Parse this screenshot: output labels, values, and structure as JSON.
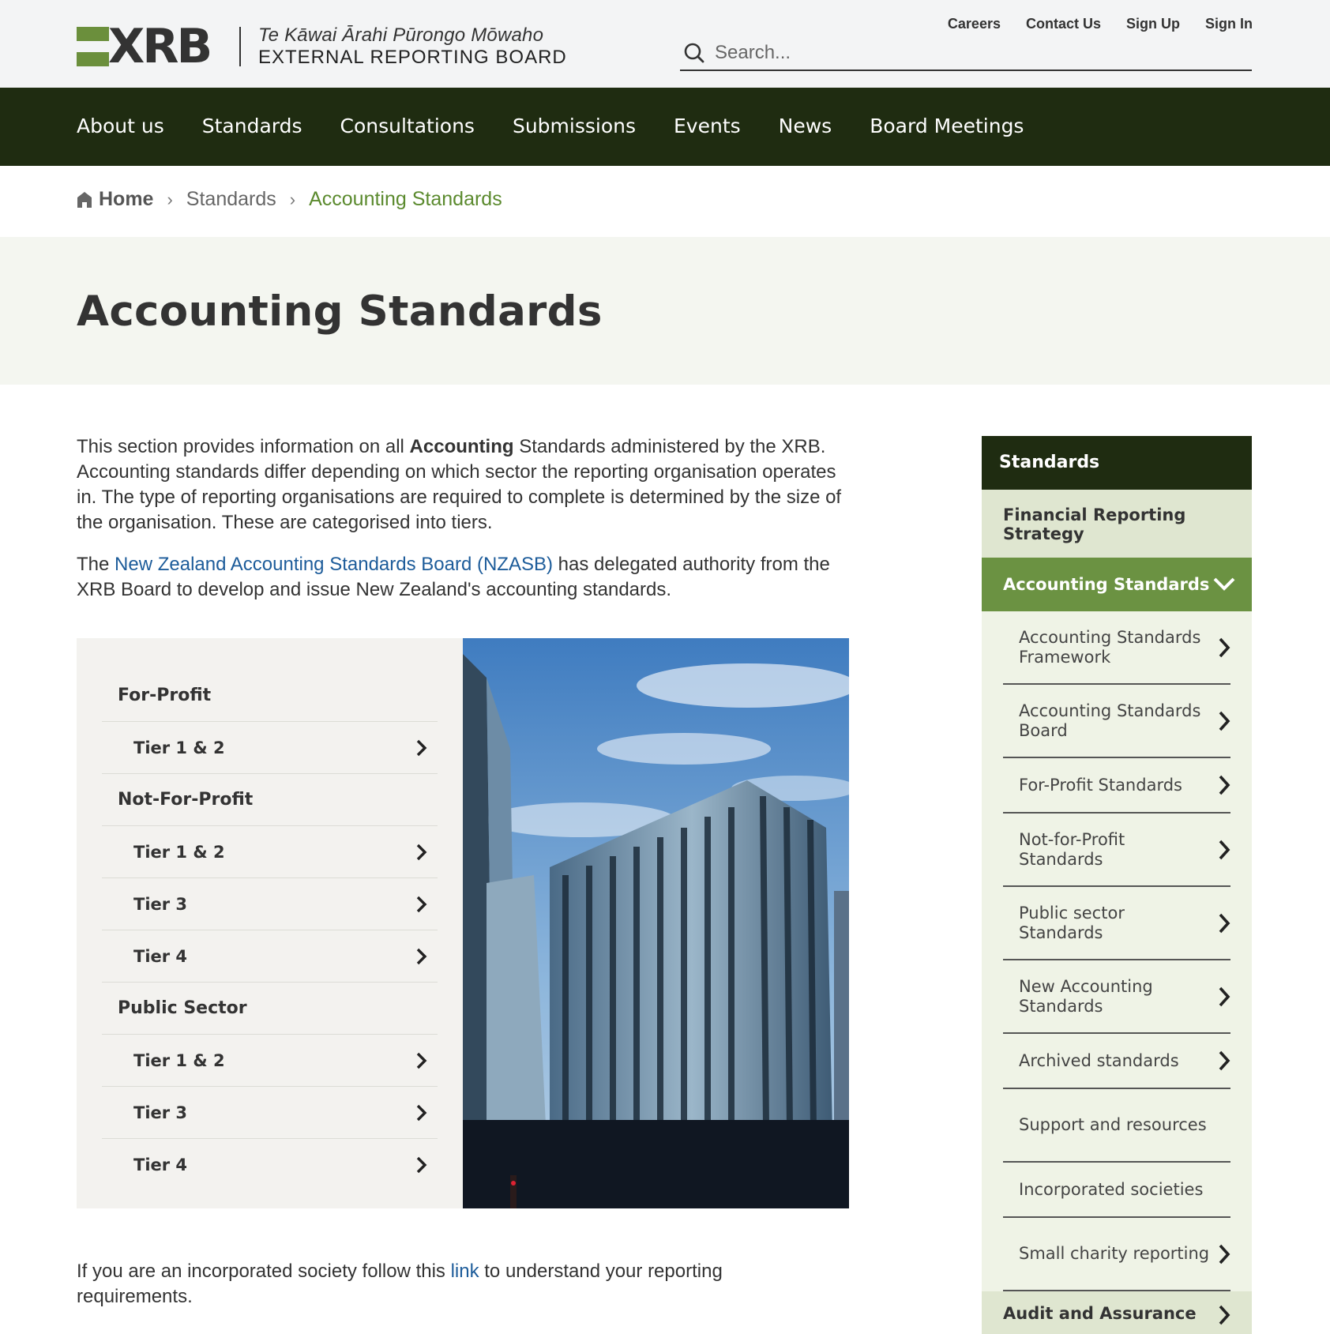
{
  "logo": {
    "mark_text": "XRB",
    "maori_name": "Te Kāwai Ārahi Pūrongo Mōwaho",
    "english_name": "EXTERNAL REPORTING BOARD"
  },
  "utility_links": [
    "Careers",
    "Contact Us",
    "Sign Up",
    "Sign In"
  ],
  "search": {
    "placeholder": "Search..."
  },
  "main_nav": [
    "About us",
    "Standards",
    "Consultations",
    "Submissions",
    "Events",
    "News",
    "Board Meetings"
  ],
  "breadcrumb": {
    "home": "Home",
    "parent": "Standards",
    "current": "Accounting Standards"
  },
  "page_title": "Accounting Standards",
  "intro": {
    "p1_before": "This section provides information on all ",
    "p1_bold": "Accounting",
    "p1_after": " Standards administered by the XRB. Accounting standards differ depending on which sector the reporting organisation operates in. The type of reporting organisations are required to complete is determined by the size of the organisation. These are categorised into tiers.",
    "p2_before": "The ",
    "p2_link": "New Zealand Accounting Standards Board (NZASB)",
    "p2_after": " has delegated authority from the XRB Board to develop and issue New Zealand's accounting standards."
  },
  "tiers": {
    "for_profit": {
      "label": "For-Profit",
      "items": [
        "Tier 1 & 2"
      ]
    },
    "not_for_profit": {
      "label": "Not-For-Profit",
      "items": [
        "Tier 1 & 2",
        "Tier 3",
        "Tier 4"
      ]
    },
    "public_sector": {
      "label": "Public Sector",
      "items": [
        "Tier 1 & 2",
        "Tier 3",
        "Tier 4"
      ]
    }
  },
  "incorporated_note": {
    "before": "If you are an incorporated society follow this ",
    "link": "link",
    "after": " to understand your reporting requirements."
  },
  "sidebar": {
    "header": "Standards",
    "financial_reporting": "Financial Reporting Strategy",
    "active": "Accounting Standards",
    "items": [
      "Accounting Standards Framework",
      "Accounting Standards Board",
      "For-Profit Standards",
      "Not-for-Profit Standards",
      "Public sector Standards",
      "New Accounting Standards",
      "Archived standards",
      "Support and resources",
      "Incorporated societies",
      "Small charity reporting"
    ],
    "next_section": "Audit and Assurance"
  },
  "colors": {
    "nav_bg": "#1f2c11",
    "brand_green": "#6b9242",
    "link_blue": "#1d5c9a"
  }
}
